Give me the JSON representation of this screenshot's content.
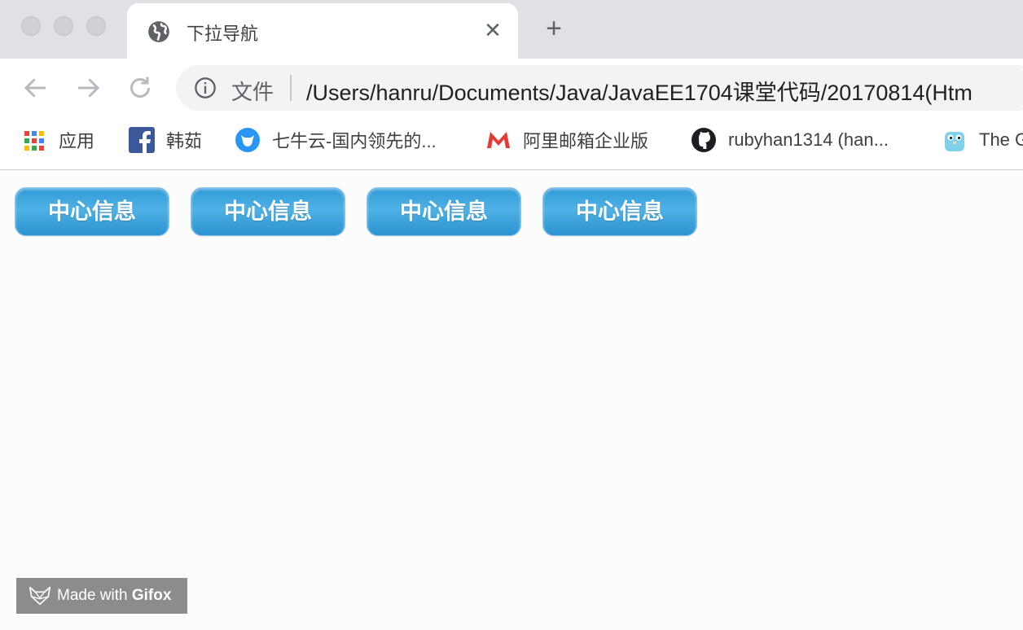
{
  "window": {
    "tab": {
      "title": "下拉导航",
      "icon": "globe-icon"
    }
  },
  "toolbar": {
    "omnibox": {
      "security_label": "文件",
      "url": "/Users/hanru/Documents/Java/JavaEE1704课堂代码/20170814(Htm"
    }
  },
  "bookmarks": [
    {
      "label": "应用",
      "icon": "apps-grid-icon"
    },
    {
      "label": "韩茹",
      "icon": "facebook-icon"
    },
    {
      "label": "七牛云-国内领先的...",
      "icon": "qiniu-icon"
    },
    {
      "label": "阿里邮箱企业版",
      "icon": "aliyun-mail-icon"
    },
    {
      "label": "rubyhan1314 (han...",
      "icon": "github-icon"
    },
    {
      "label": "The G",
      "icon": "golang-gopher-icon"
    }
  ],
  "page": {
    "nav_buttons": [
      {
        "label": "中心信息"
      },
      {
        "label": "中心信息"
      },
      {
        "label": "中心信息"
      },
      {
        "label": "中心信息"
      }
    ]
  },
  "watermark": {
    "prefix": "Made with ",
    "brand": "Gifox"
  },
  "colors": {
    "button_blue": "#3aa3dc",
    "tab_strip": "#dfe1e5",
    "omnibox": "#f1f3f4"
  }
}
